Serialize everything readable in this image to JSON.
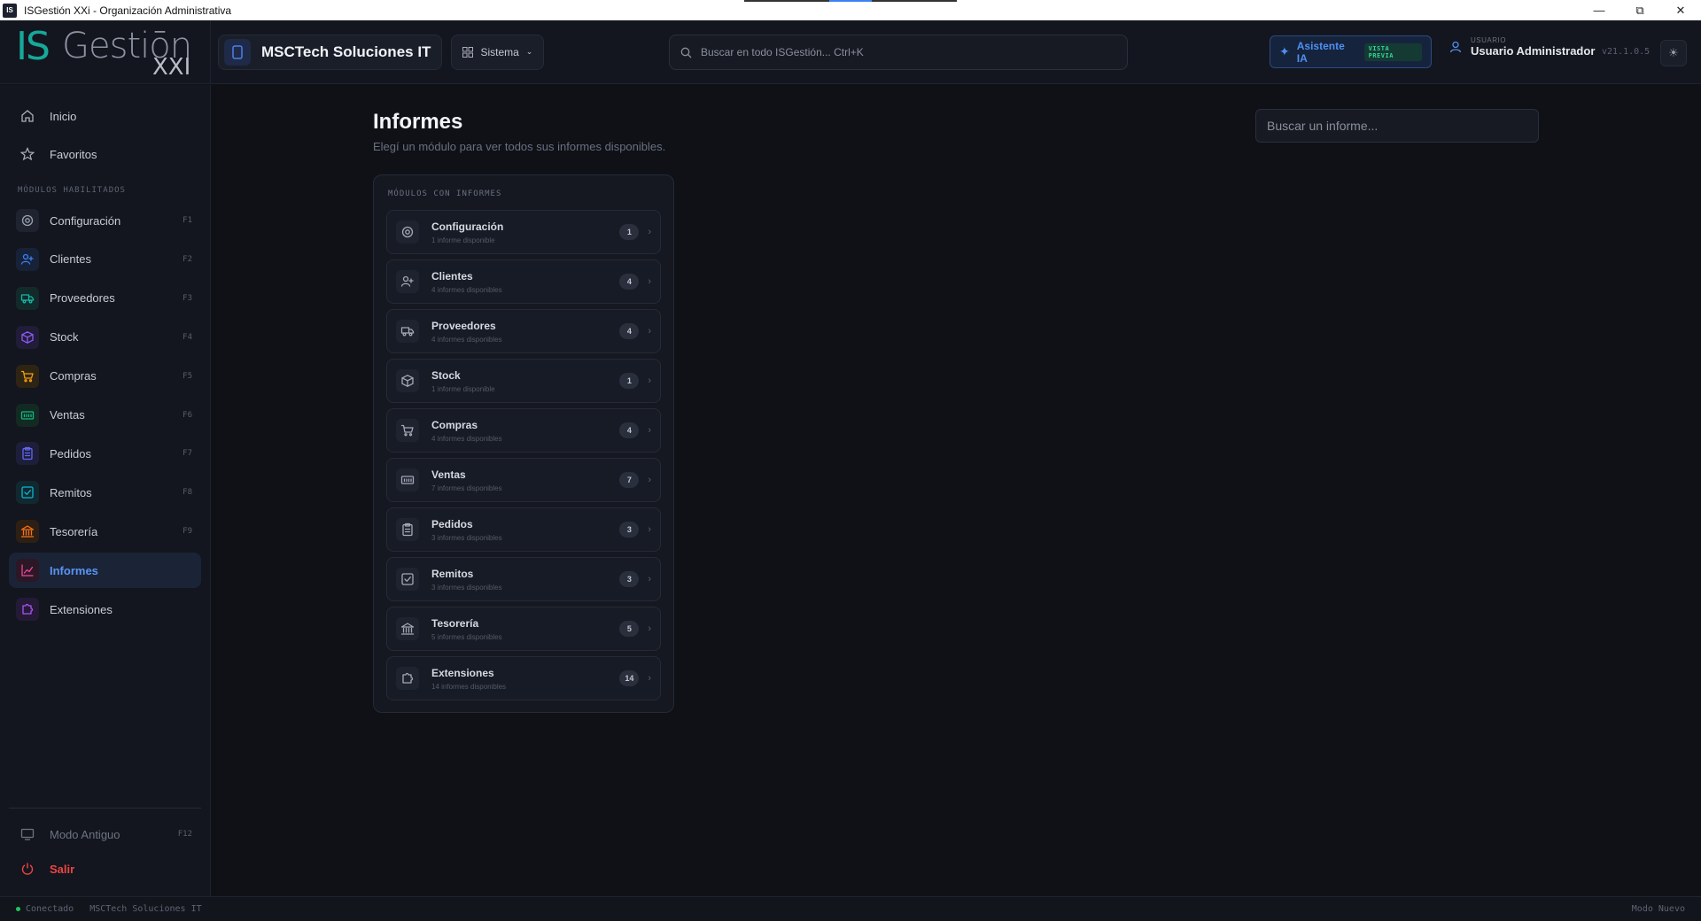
{
  "window": {
    "title": "ISGestión XXi - Organización Administrativa",
    "app_icon": "IS"
  },
  "header": {
    "logo": {
      "is": "IS",
      "gestion": "Gestiōn",
      "xxi": "XXI"
    },
    "company": "MSCTech Soluciones IT",
    "system_menu": "Sistema",
    "search_placeholder": "Buscar en todo ISGestión...  Ctrl+K",
    "ai_button": {
      "label": "Asistente IA",
      "badge": "VISTA PREVIA"
    },
    "user": {
      "label": "USUARIO",
      "name": "Usuario Administrador"
    },
    "version": "v21.1.0.5"
  },
  "sidebar": {
    "top_items": [
      {
        "label": "Inicio",
        "icon": "home-icon"
      },
      {
        "label": "Favoritos",
        "icon": "star-icon"
      }
    ],
    "section_title": "MÓDULOS HABILITADOS",
    "modules": [
      {
        "label": "Configuración",
        "key": "F1",
        "icon": "gear-icon",
        "color": "#9aa0ad",
        "bg": "#1f2330"
      },
      {
        "label": "Clientes",
        "key": "F2",
        "icon": "users-icon",
        "color": "#3b82f6",
        "bg": "#172238"
      },
      {
        "label": "Proveedores",
        "key": "F3",
        "icon": "truck-icon",
        "color": "#14b8a6",
        "bg": "#132a2b"
      },
      {
        "label": "Stock",
        "key": "F4",
        "icon": "box-icon",
        "color": "#8b5cf6",
        "bg": "#211c38"
      },
      {
        "label": "Compras",
        "key": "F5",
        "icon": "cart-icon",
        "color": "#f59e0b",
        "bg": "#2e2414"
      },
      {
        "label": "Ventas",
        "key": "F6",
        "icon": "register-icon",
        "color": "#10b981",
        "bg": "#132a22"
      },
      {
        "label": "Pedidos",
        "key": "F7",
        "icon": "clipboard-icon",
        "color": "#6366f1",
        "bg": "#1d1f3a"
      },
      {
        "label": "Remitos",
        "key": "F8",
        "icon": "check-square-icon",
        "color": "#06b6d4",
        "bg": "#12282f"
      },
      {
        "label": "Tesorería",
        "key": "F9",
        "icon": "bank-icon",
        "color": "#f97316",
        "bg": "#2e1f14"
      },
      {
        "label": "Informes",
        "key": "",
        "icon": "chart-line-icon",
        "color": "#ec4899",
        "bg": "#2c1726",
        "active": true
      },
      {
        "label": "Extensiones",
        "key": "",
        "icon": "puzzle-icon",
        "color": "#a855f7",
        "bg": "#251a36"
      }
    ],
    "bottom": {
      "legacy_mode": {
        "label": "Modo Antiguo",
        "key": "F12"
      },
      "exit": {
        "label": "Salir"
      }
    }
  },
  "main": {
    "title": "Informes",
    "subtitle": "Elegí un módulo para ver todos sus informes disponibles.",
    "search_placeholder": "Buscar un informe...",
    "panel_title": "MÓDULOS CON INFORMES",
    "modules": [
      {
        "name": "Configuración",
        "desc": "1 informe disponible",
        "count": "1",
        "icon": "gear-icon"
      },
      {
        "name": "Clientes",
        "desc": "4 informes disponibles",
        "count": "4",
        "icon": "users-icon"
      },
      {
        "name": "Proveedores",
        "desc": "4 informes disponibles",
        "count": "4",
        "icon": "truck-icon"
      },
      {
        "name": "Stock",
        "desc": "1 informe disponible",
        "count": "1",
        "icon": "box-icon"
      },
      {
        "name": "Compras",
        "desc": "4 informes disponibles",
        "count": "4",
        "icon": "cart-icon"
      },
      {
        "name": "Ventas",
        "desc": "7 informes disponibles",
        "count": "7",
        "icon": "register-icon"
      },
      {
        "name": "Pedidos",
        "desc": "3 informes disponibles",
        "count": "3",
        "icon": "clipboard-icon"
      },
      {
        "name": "Remitos",
        "desc": "3 informes disponibles",
        "count": "3",
        "icon": "check-square-icon"
      },
      {
        "name": "Tesorería",
        "desc": "5 informes disponibles",
        "count": "5",
        "icon": "bank-icon"
      },
      {
        "name": "Extensiones",
        "desc": "14 informes disponibles",
        "count": "14",
        "icon": "puzzle-icon"
      }
    ]
  },
  "statusbar": {
    "status": "Conectado",
    "company": "MSCTech Soluciones IT",
    "mode": "Modo Nuevo"
  },
  "colors": {
    "accent": "#3b82f6",
    "danger": "#ef4444",
    "connected": "#22c55e"
  }
}
